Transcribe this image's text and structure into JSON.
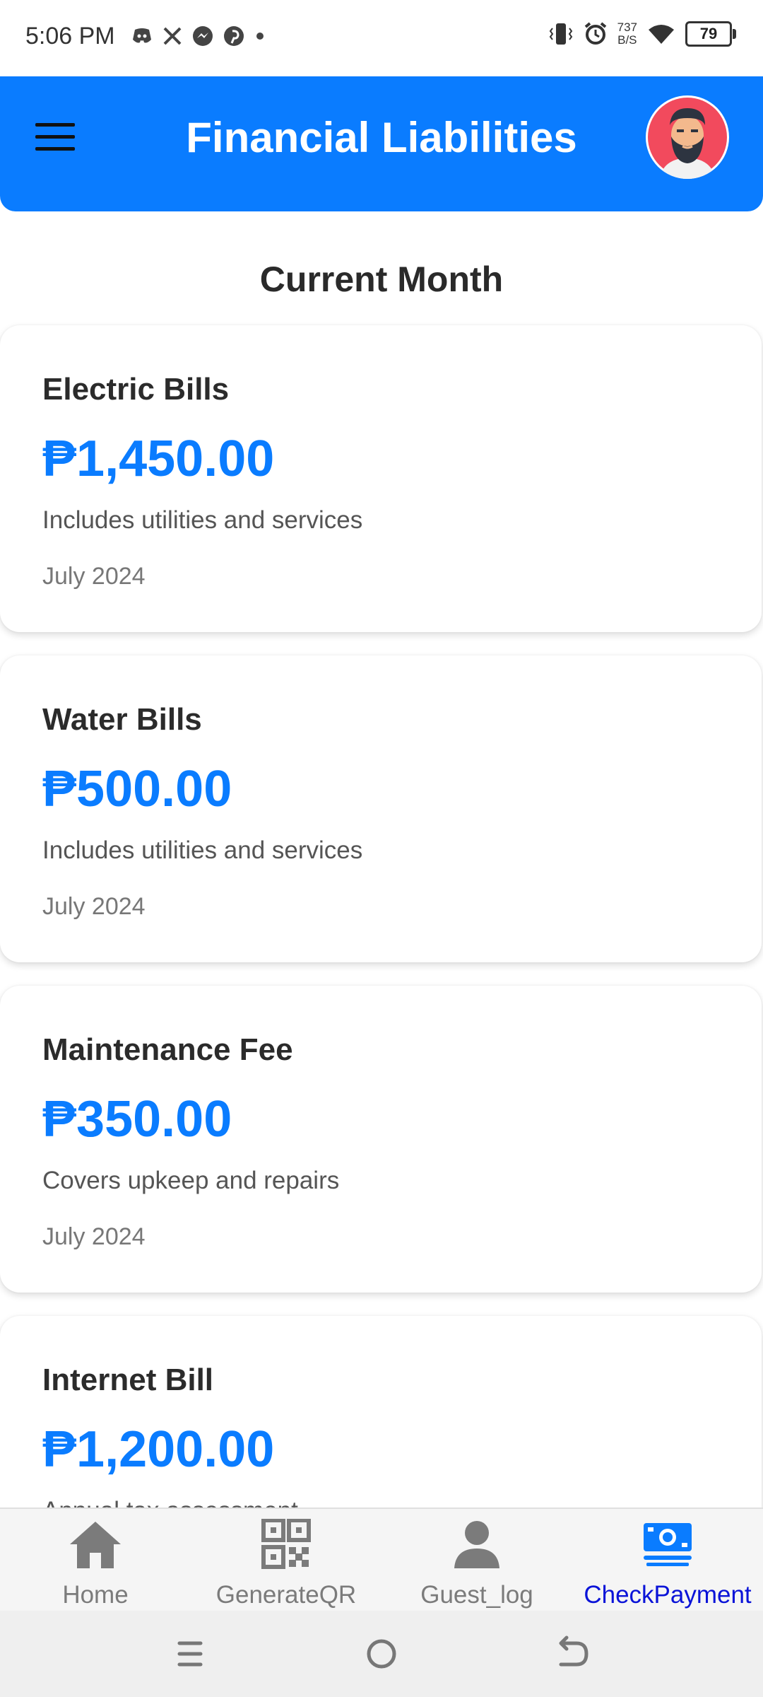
{
  "status_bar": {
    "time": "5:06 PM",
    "left_icons": [
      "discord-icon",
      "x-icon",
      "messenger-icon",
      "pinterest-icon",
      "dot-icon"
    ],
    "net_speed_value": "737",
    "net_speed_unit": "B/S",
    "battery": "79",
    "battery_level": 0.79
  },
  "header": {
    "title": "Financial Liabilities",
    "menu_icon": "hamburger-menu-icon",
    "avatar_icon": "bearded-man-avatar"
  },
  "section": {
    "title": "Current Month"
  },
  "bills": [
    {
      "title": "Electric Bills",
      "amount": "₱1,450.00",
      "description": "Includes utilities and services",
      "date": "July 2024"
    },
    {
      "title": "Water Bills",
      "amount": "₱500.00",
      "description": "Includes utilities and services",
      "date": "July 2024"
    },
    {
      "title": "Maintenance Fee",
      "amount": "₱350.00",
      "description": "Covers upkeep and repairs",
      "date": "July 2024"
    },
    {
      "title": "Internet Bill",
      "amount": "₱1,200.00",
      "description": "Annual tax assessment",
      "date": ""
    }
  ],
  "bottom_nav": [
    {
      "label": "Home",
      "icon": "home-icon",
      "active": false
    },
    {
      "label": "GenerateQR",
      "icon": "qr-code-icon",
      "active": false
    },
    {
      "label": "Guest_log",
      "icon": "person-icon",
      "active": false
    },
    {
      "label": "CheckPayment",
      "icon": "money-icon",
      "active": true
    }
  ],
  "colors": {
    "primary": "#0a7cff",
    "active_nav": "#0a13d8",
    "inactive_nav": "#7b7b7b"
  }
}
